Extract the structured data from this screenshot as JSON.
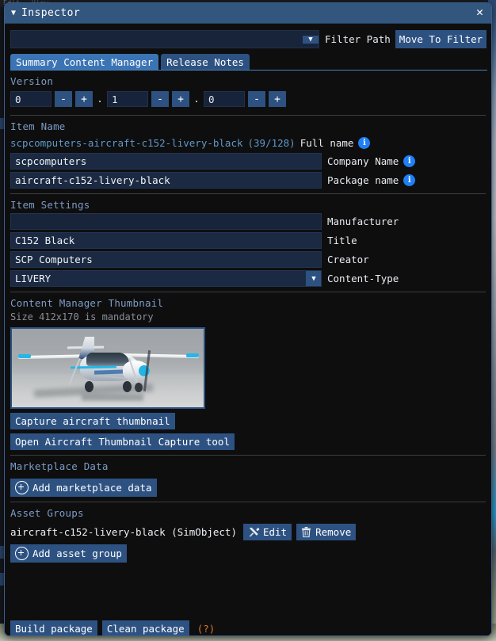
{
  "desktop": {
    "menubar_items": [
      "Edit",
      "View"
    ]
  },
  "window": {
    "title": "Inspector",
    "collapse_icon": "triangle-down-icon",
    "close_icon": "close-icon"
  },
  "filter_bar": {
    "path_value": "",
    "path_placeholder": "",
    "dropdown_icon": "chevron-down-icon",
    "label": "Filter Path",
    "move_button": "Move To Filter"
  },
  "tabs": [
    {
      "label": "Summary Content Manager",
      "active": true
    },
    {
      "label": "Release Notes",
      "active": false
    }
  ],
  "sections": {
    "version": {
      "label": "Version",
      "major": "0",
      "minor": "1",
      "patch": "0",
      "separator": ".",
      "minus_label": "-",
      "plus_label": "+"
    },
    "item_name": {
      "label": "Item Name",
      "full_name_value": "scpcomputers-aircraft-c152-livery-black",
      "full_name_count": "(39/128)",
      "full_name_caption": "Full name",
      "company_name": "scpcomputers",
      "company_caption": "Company Name",
      "package_name": "aircraft-c152-livery-black",
      "package_caption": "Package name"
    },
    "item_settings": {
      "label": "Item Settings",
      "manufacturer_value": "",
      "manufacturer_caption": "Manufacturer",
      "title_value": "C152 Black",
      "title_caption": "Title",
      "creator_value": "SCP Computers",
      "creator_caption": "Creator",
      "content_type_value": "LIVERY",
      "content_type_caption": "Content-Type"
    },
    "thumbnail": {
      "label": "Content Manager Thumbnail",
      "size_note": "Size 412x170 is mandatory",
      "image_alt": "cessna-152-aircraft-render",
      "capture_button": "Capture aircraft thumbnail",
      "tool_button": "Open Aircraft Thumbnail Capture tool"
    },
    "marketplace": {
      "label": "Marketplace Data",
      "add_button": "Add marketplace data",
      "add_icon": "plus-circle-icon"
    },
    "asset_groups": {
      "label": "Asset Groups",
      "item_name": "aircraft-c152-livery-black (SimObject)",
      "edit_button": "Edit",
      "edit_icon": "tools-icon",
      "remove_button": "Remove",
      "remove_icon": "trash-icon",
      "add_button": "Add asset group",
      "add_icon": "plus-circle-icon"
    }
  },
  "footer": {
    "build_button": "Build package",
    "clean_button": "Clean package",
    "help_label": "(?)"
  },
  "colors": {
    "titlebar": "#33567f",
    "accent_button": "#2d5282",
    "tab_active": "#3b74b4",
    "section_heading": "#7d9cc4",
    "info_icon": "#1f7ff5",
    "help_orange": "#d4792b",
    "link_text": "#5f98c9",
    "window_bg": "#0e0e0f"
  }
}
